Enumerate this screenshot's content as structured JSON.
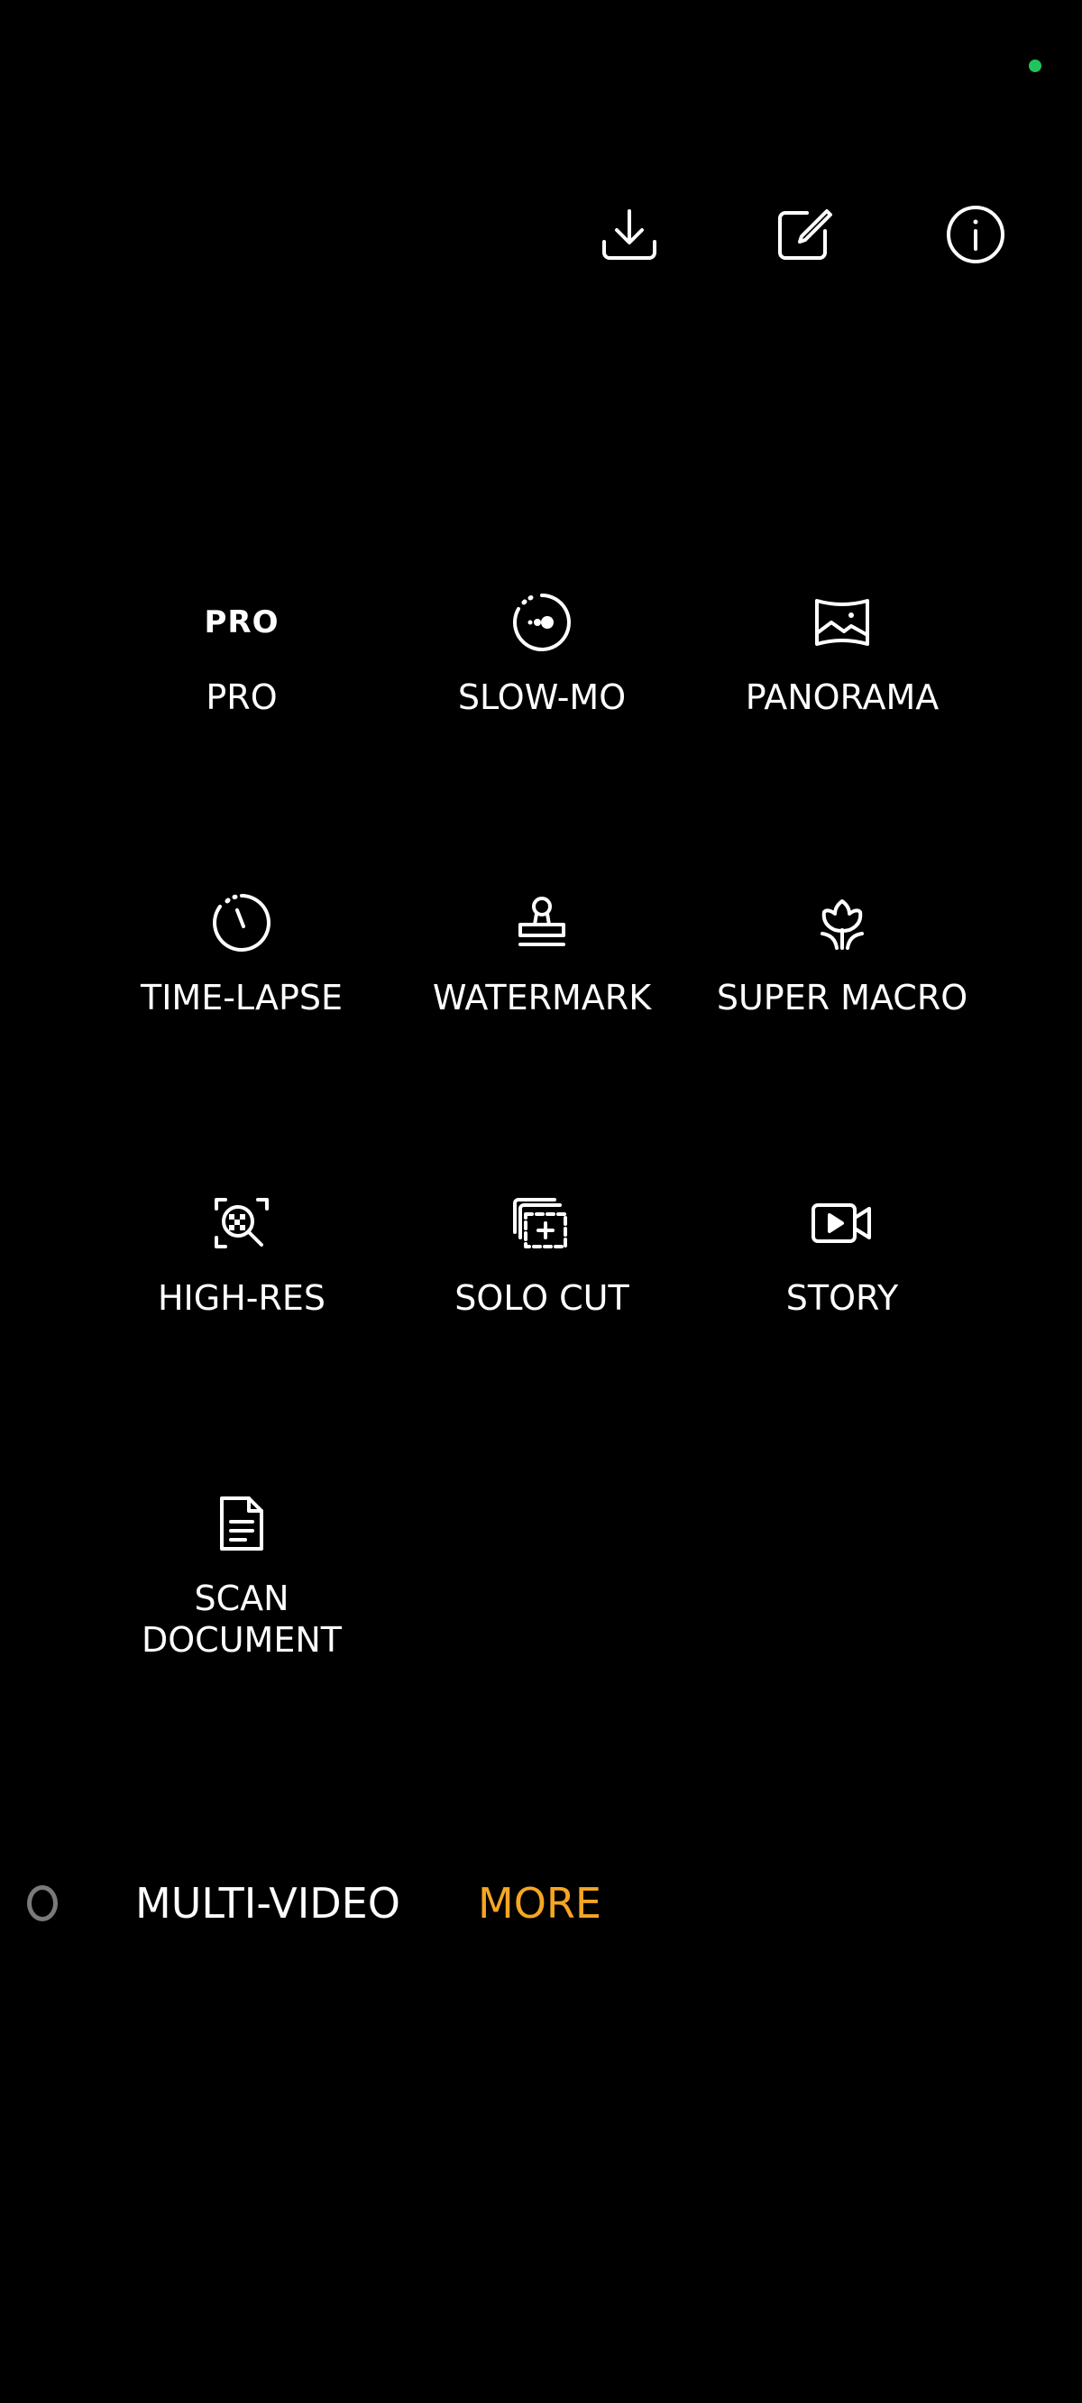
{
  "colors": {
    "background": "#000000",
    "text": "#ffffff",
    "active_mode": "#f5a623",
    "status_dot": "#21c45a"
  },
  "toolbar": {
    "download_icon": "download-icon",
    "edit_icon": "edit-icon",
    "info_icon": "info-icon"
  },
  "modes": [
    {
      "label": "PRO",
      "icon": "pro-icon",
      "glyph": "PRO"
    },
    {
      "label": "SLOW-MO",
      "icon": "slow-mo-icon"
    },
    {
      "label": "PANORAMA",
      "icon": "panorama-icon"
    },
    {
      "label": "TIME-LAPSE",
      "icon": "time-lapse-icon"
    },
    {
      "label": "WATERMARK",
      "icon": "watermark-icon"
    },
    {
      "label": "SUPER MACRO",
      "icon": "super-macro-icon"
    },
    {
      "label": "HIGH-RES",
      "icon": "high-res-icon"
    },
    {
      "label": "SOLO CUT",
      "icon": "solo-cut-icon"
    },
    {
      "label": "STORY",
      "icon": "story-icon"
    },
    {
      "label": "SCAN\nDOCUMENT",
      "icon": "scan-document-icon"
    }
  ],
  "mode_bar": {
    "items": [
      {
        "label": "MULTI-VIDEO",
        "active": false
      },
      {
        "label": "MORE",
        "active": true
      }
    ]
  }
}
